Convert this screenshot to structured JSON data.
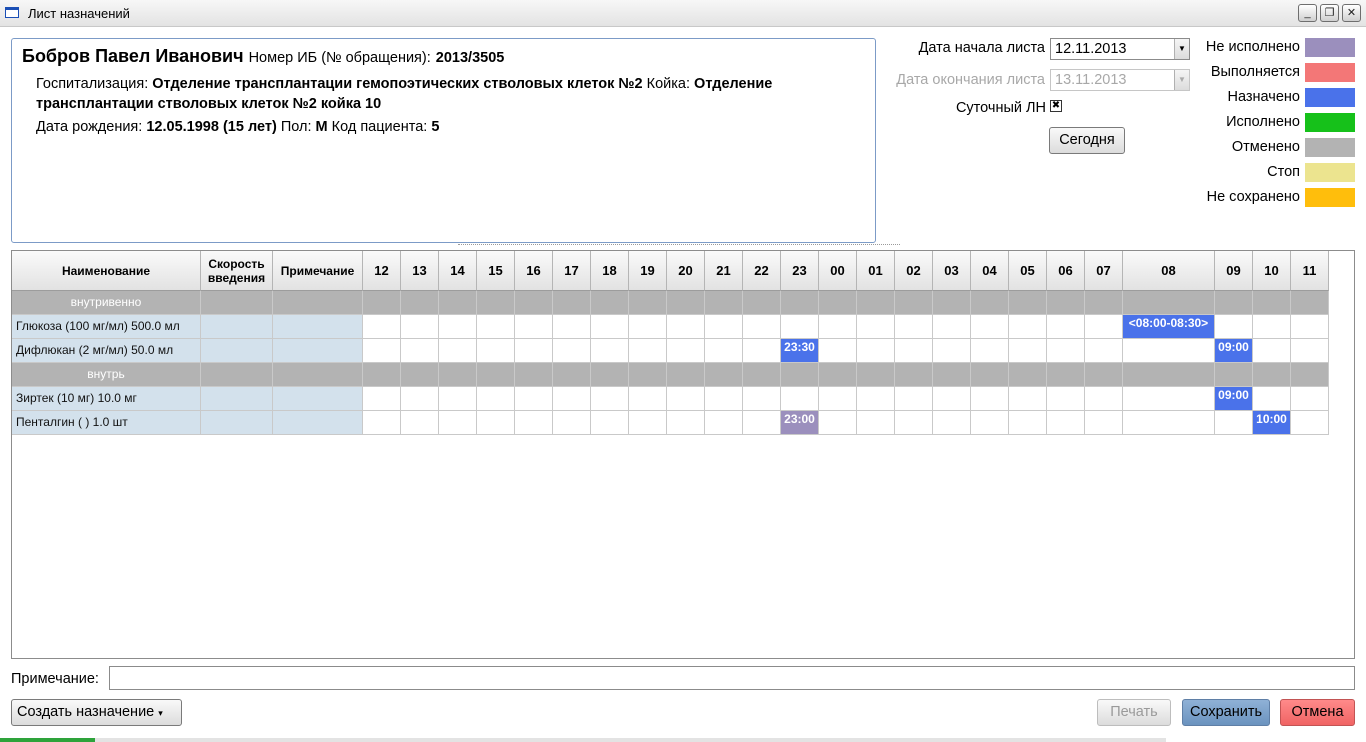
{
  "window": {
    "title": "Лист назначений"
  },
  "patient": {
    "name": "Бобров Павел Иванович",
    "ib_label": "Номер ИБ (№ обращения):",
    "ib_value": "2013/3505",
    "hosp_label": "Госпитализация:",
    "hosp_value": "Отделение трансплантации гемопоэтических стволовых клеток №2",
    "bed_label": "Койка:",
    "bed_value_1": "Отделение",
    "bed_value_2": "трансплантации стволовых клеток №2 койка 10",
    "dob_label": "Дата рождения:",
    "dob_value": "12.05.1998 (15 лет)",
    "sex_label": "Пол:",
    "sex_value": "М",
    "code_label": "Код пациента:",
    "code_value": "5"
  },
  "controls": {
    "start_label": "Дата начала листа",
    "start_value": "12.11.2013",
    "end_label": "Дата окончания листа",
    "end_value": "13.11.2013",
    "daily_label": "Суточный ЛН",
    "daily_checked": true,
    "daily_mark": "✖",
    "today_button": "Сегодня"
  },
  "legend": [
    {
      "label": "Не исполнено",
      "color": "#9b8fbd"
    },
    {
      "label": "Выполняется",
      "color": "#f37777"
    },
    {
      "label": "Назначено",
      "color": "#4a72ea"
    },
    {
      "label": "Исполнено",
      "color": "#16c11a"
    },
    {
      "label": "Отменено",
      "color": "#b3b3b3"
    },
    {
      "label": "Стоп",
      "color": "#ece48f"
    },
    {
      "label": "Не сохранено",
      "color": "#ffbe0c"
    }
  ],
  "grid": {
    "headers": {
      "name": "Наименование",
      "speed": "Скорость введения",
      "note": "Примечание"
    },
    "hours": [
      "12",
      "13",
      "14",
      "15",
      "16",
      "17",
      "18",
      "19",
      "20",
      "21",
      "22",
      "23",
      "00",
      "01",
      "02",
      "03",
      "04",
      "05",
      "06",
      "07",
      "08",
      "09",
      "10",
      "11"
    ],
    "rows": [
      {
        "type": "group",
        "label": "внутривенно"
      },
      {
        "type": "item",
        "name": "Глюкоза (100 мг/мл) 500.0 мл",
        "events": [
          {
            "hour": "08",
            "label": "<08:00-08:30>",
            "status": "Назначено"
          }
        ]
      },
      {
        "type": "item",
        "name": "Дифлюкан (2 мг/мл) 50.0 мл",
        "events": [
          {
            "hour": "23",
            "label": "23:30",
            "status": "Назначено"
          },
          {
            "hour": "09",
            "label": "09:00",
            "status": "Назначено"
          }
        ]
      },
      {
        "type": "group",
        "label": "внутрь"
      },
      {
        "type": "item",
        "name": "Зиртек (10 мг) 10.0 мг",
        "events": [
          {
            "hour": "09",
            "label": "09:00",
            "status": "Назначено"
          }
        ]
      },
      {
        "type": "item",
        "name": "Пенталгин ( ) 1.0 шт",
        "events": [
          {
            "hour": "23",
            "label": "23:00",
            "status": "Не исполнено"
          },
          {
            "hour": "10",
            "label": "10:00",
            "status": "Назначено"
          }
        ]
      }
    ]
  },
  "footer": {
    "note_label": "Примечание:",
    "note_value": "",
    "create_button": "Создать назначение",
    "create_arrow": "▾",
    "print_button": "Печать",
    "save_button": "Сохранить",
    "cancel_button": "Отмена"
  }
}
